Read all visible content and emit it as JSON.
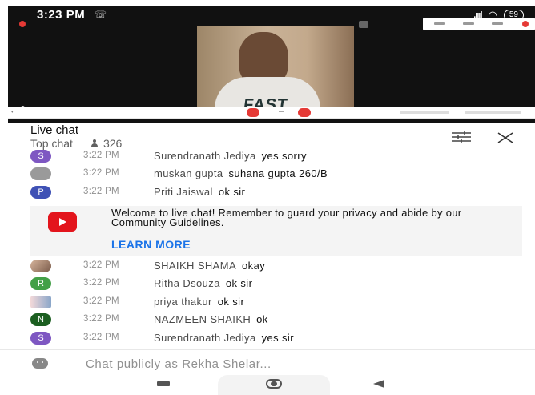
{
  "status_bar": {
    "time": "3:23 PM",
    "notification_icon": "whatsapp-icon",
    "signal": ".ıııl",
    "wifi_icon": "wifi-icon",
    "battery": "59"
  },
  "meeting": {
    "shirt_text": "FAST"
  },
  "chat": {
    "title": "Live chat",
    "mode": "Top chat",
    "viewer_count": "326"
  },
  "messages_before": [
    {
      "avatar_letter": "S",
      "avatar_color": "#7e57c2",
      "time": "3:22 PM",
      "author": "Surendranath Jediya",
      "text": "yes sorry"
    },
    {
      "avatar_letter": "",
      "avatar_color": "#9a9a9a",
      "time": "3:22 PM",
      "author": "muskan gupta",
      "text": "suhana gupta 260/B"
    },
    {
      "avatar_letter": "P",
      "avatar_color": "#3f51b5",
      "time": "3:22 PM",
      "author": "Priti Jaiswal",
      "text": "ok sir"
    }
  ],
  "welcome": {
    "text": "Welcome to live chat! Remember to guard your privacy and abide by our Community Guidelines.",
    "link": "LEARN MORE"
  },
  "messages_after": [
    {
      "avatar_letter": "",
      "avatar_color": "#b08a73",
      "time": "3:22 PM",
      "author": "SHAIKH SHAMA",
      "text": "okay"
    },
    {
      "avatar_letter": "R",
      "avatar_color": "#43a047",
      "time": "3:22 PM",
      "author": "Ritha Dsouza",
      "text": "ok sir"
    },
    {
      "avatar_letter": "",
      "avatar_color": "#c7c7d9",
      "time": "3:22 PM",
      "author": "priya thakur",
      "text": "ok sir"
    },
    {
      "avatar_letter": "N",
      "avatar_color": "#1b5e20",
      "time": "3:22 PM",
      "author": "NAZMEEN SHAIKH",
      "text": "ok"
    },
    {
      "avatar_letter": "S",
      "avatar_color": "#7e57c2",
      "time": "3:22 PM",
      "author": "Surendranath Jediya",
      "text": "yes sir"
    }
  ],
  "input": {
    "placeholder": "Chat publicly as Rekha Shelar..."
  }
}
